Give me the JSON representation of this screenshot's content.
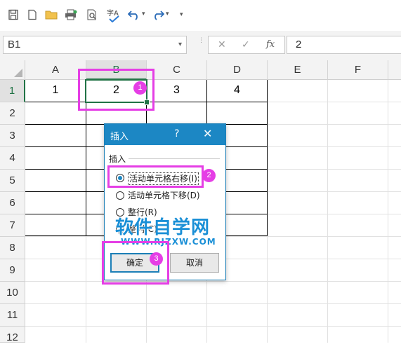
{
  "toolbar": {
    "icons": [
      "save-icon",
      "open-folder-icon",
      "print-icon",
      "print-preview-icon",
      "spellcheck-icon",
      "undo-icon",
      "redo-icon",
      "customize-icon"
    ],
    "spell_glyph": "字A",
    "fx_glyph": "fx",
    "dropdown_glyph": "▾"
  },
  "formula_bar": {
    "name_box": "B1",
    "formula_value": "2",
    "cancel_glyph": "✕",
    "enter_glyph": "✓"
  },
  "grid": {
    "columns": [
      "A",
      "B",
      "C",
      "D",
      "E",
      "F"
    ],
    "rows": [
      "1",
      "2",
      "3",
      "4",
      "5",
      "6",
      "7",
      "8",
      "9",
      "10",
      "11",
      "12"
    ],
    "row1_values": [
      "1",
      "2",
      "3",
      "4"
    ],
    "selected_cell": "B1"
  },
  "dialog": {
    "title": "插入",
    "help": "?",
    "close": "✕",
    "group_label": "插入",
    "options": [
      {
        "label": "活动单元格右移(I)",
        "selected": true
      },
      {
        "label": "活动单元格下移(D)",
        "selected": false
      },
      {
        "label": "整行(R)",
        "selected": false
      },
      {
        "label": "整列(C)",
        "selected": false
      }
    ],
    "ok": "确定",
    "cancel": "取消"
  },
  "watermark": {
    "title": "软件自学网",
    "url": "WWW.RJZXW.COM"
  },
  "annotations": [
    "1",
    "2",
    "3"
  ],
  "colors": {
    "accent": "#1c87c4",
    "highlight": "#e53ee5",
    "excel_green": "#217346"
  }
}
